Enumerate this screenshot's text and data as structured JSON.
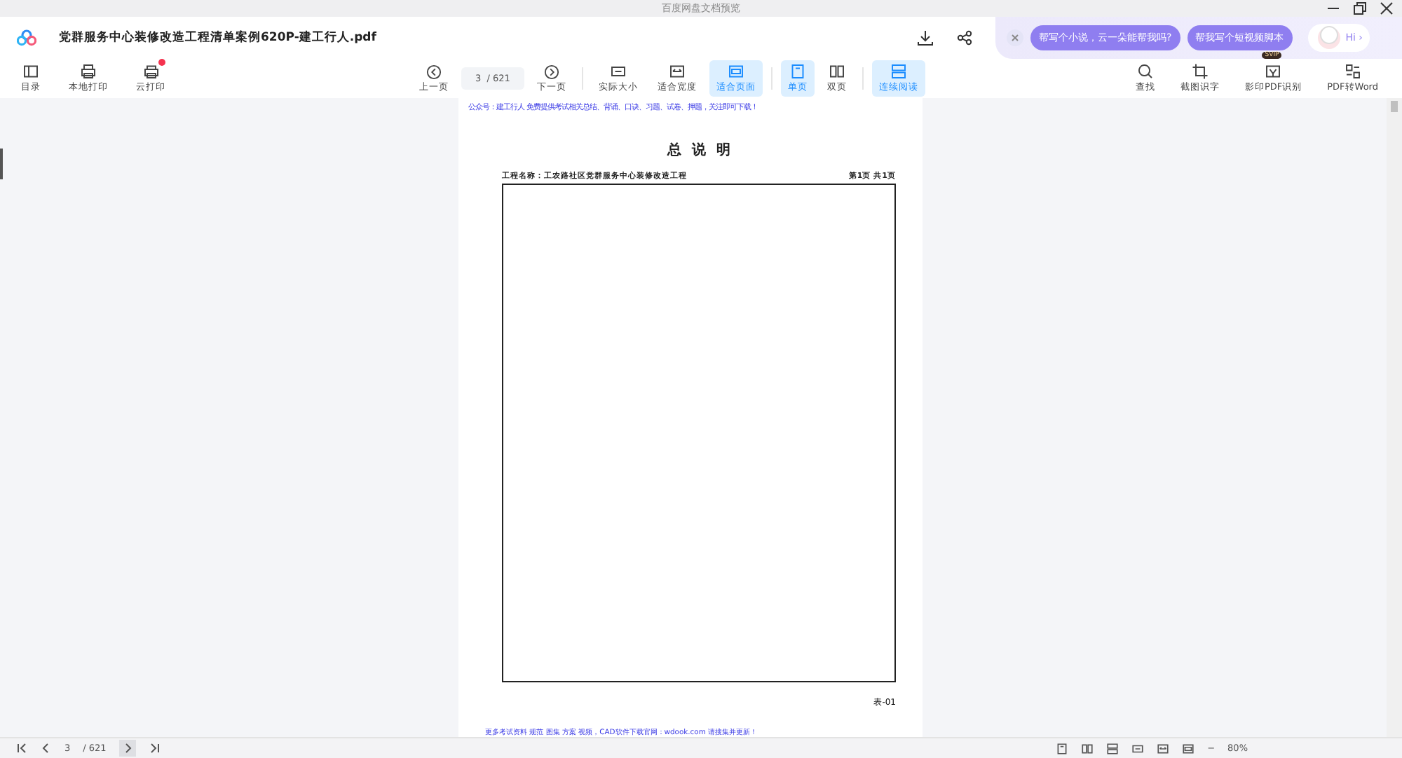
{
  "window": {
    "title": "百度网盘文档预览"
  },
  "header": {
    "file_name": "党群服务中心装修改造工程清单案例620P-建工行人.pdf",
    "ai_prompts": [
      "帮写个小说，云一朵能帮我吗?",
      "帮我写个短视频脚本"
    ],
    "assistant_greeting": "Hi ›"
  },
  "toolbar": {
    "left": [
      {
        "label": "目录",
        "dot": false
      },
      {
        "label": "本地打印",
        "dot": false
      },
      {
        "label": "云打印",
        "dot": true
      }
    ],
    "page_nav": {
      "prev": "上一页",
      "current": "3",
      "total": "/ 621",
      "next": "下一页"
    },
    "views": [
      {
        "label": "实际大小",
        "selected": false
      },
      {
        "label": "适合宽度",
        "selected": false
      },
      {
        "label": "适合页面",
        "selected": true
      },
      {
        "label": "单页",
        "selected": true
      },
      {
        "label": "双页",
        "selected": false
      },
      {
        "label": "连续阅读",
        "selected": true
      }
    ],
    "right": [
      {
        "label": "查找"
      },
      {
        "label": "截图识字"
      },
      {
        "label": "影印PDF识别",
        "badge": "SVIP"
      },
      {
        "label": "PDF转Word"
      }
    ]
  },
  "document": {
    "notice": "公众号：建工行人 免费提供考试相关总结、背诵、口诀、习题、试卷、押题，关注即可下载！",
    "title": "总 说 明",
    "project": "工程名称：工农路社区党群服务中心装修改造工程",
    "page_info": "第1页 共1页",
    "table_id": "表-01",
    "footer": "更多考试资料 规范 图集 方案 视频，CAD软件下载官网：wdook.com 请搜集并更新！"
  },
  "status_bar": {
    "current": "3",
    "total": "/ 621",
    "zoom_minus": "−",
    "zoom": "80%"
  }
}
